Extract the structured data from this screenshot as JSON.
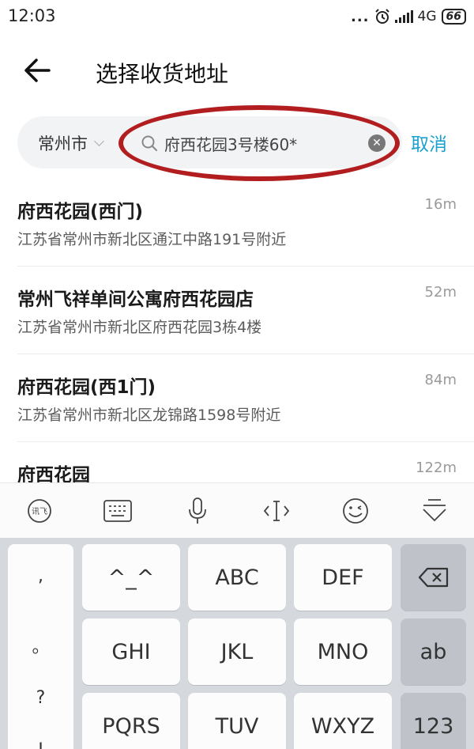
{
  "status_bar": {
    "time": "12:03",
    "dots": "...",
    "network": "4G",
    "battery": "66"
  },
  "header": {
    "title": "选择收货地址"
  },
  "search": {
    "city": "常州市",
    "query": "府西花园3号楼60*",
    "cancel_label": "取消"
  },
  "results": [
    {
      "name": "府西花园(西门)",
      "address": "江苏省常州市新北区通江中路191号附近",
      "distance": "16m"
    },
    {
      "name": "常州飞祥单间公寓府西花园店",
      "address": "江苏省常州市新北区府西花园3栋4楼",
      "distance": "52m"
    },
    {
      "name": "府西花园(西1门)",
      "address": "江苏省常州市新北区龙锦路1598号附近",
      "distance": "84m"
    },
    {
      "name": "府西花园",
      "address": "",
      "distance": "122m"
    }
  ],
  "keyboard": {
    "toolbar_icons": [
      "ifly-logo-icon",
      "keyboard-icon",
      "microphone-icon",
      "cursor-move-icon",
      "emoji-icon",
      "collapse-keyboard-icon"
    ],
    "punctuation": [
      ",",
      "。",
      "?",
      "!"
    ],
    "keys": {
      "emoticon": "^_^",
      "abc": "ABC",
      "def": "DEF",
      "ghi": "GHI",
      "jkl": "JKL",
      "mno": "MNO",
      "ab": "ab",
      "pqrs": "PQRS",
      "tuv": "TUV",
      "wxyz": "WXYZ",
      "num": "123"
    }
  },
  "colors": {
    "accent": "#1aa1ce",
    "annotation": "#b21d1f",
    "keyboard_bg": "#d5d8dd"
  }
}
